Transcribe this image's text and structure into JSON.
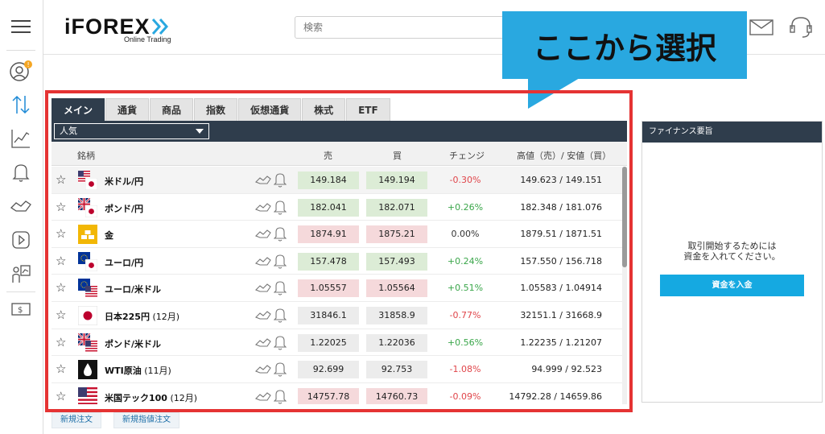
{
  "header": {
    "logo_main": "iFOREX",
    "logo_sub": "Online Trading",
    "search_placeholder": "検索"
  },
  "callout": {
    "text": "ここから選択",
    "color": "#29a8e0"
  },
  "tabs": [
    {
      "label": "メイン",
      "active": true
    },
    {
      "label": "通貨"
    },
    {
      "label": "商品"
    },
    {
      "label": "指数"
    },
    {
      "label": "仮想通貨"
    },
    {
      "label": "株式"
    },
    {
      "label": "ETF"
    }
  ],
  "filter": {
    "selected": "人気"
  },
  "table": {
    "headers": {
      "symbol": "銘柄",
      "sell": "売",
      "buy": "買",
      "change": "チェンジ",
      "highlow": "高値（売）/ 安値（買）"
    },
    "rows": [
      {
        "name": "米ドル/円",
        "sub": "",
        "flag": "us-jp",
        "sell": "149.184",
        "buy": "149.194",
        "trend": "up",
        "change": "-0.30%",
        "change_dir": "neg",
        "highlow": "149.623 / 149.151"
      },
      {
        "name": "ポンド/円",
        "sub": "",
        "flag": "uk-jp",
        "sell": "182.041",
        "buy": "182.071",
        "trend": "up",
        "change": "+0.26%",
        "change_dir": "pos",
        "highlow": "182.348 / 181.076"
      },
      {
        "name": "金",
        "sub": "",
        "flag": "gold",
        "sell": "1874.91",
        "buy": "1875.21",
        "trend": "down",
        "change": "0.00%",
        "change_dir": "zero",
        "highlow": "1879.51 / 1871.51"
      },
      {
        "name": "ユーロ/円",
        "sub": "",
        "flag": "eu-jp",
        "sell": "157.478",
        "buy": "157.493",
        "trend": "up",
        "change": "+0.24%",
        "change_dir": "pos",
        "highlow": "157.550 / 156.718"
      },
      {
        "name": "ユーロ/米ドル",
        "sub": "",
        "flag": "eu-us",
        "sell": "1.05557",
        "buy": "1.05564",
        "trend": "down",
        "change": "+0.51%",
        "change_dir": "pos",
        "highlow": "1.05583 / 1.04914"
      },
      {
        "name": "日本225円",
        "sub": " (12月)",
        "flag": "jp",
        "sell": "31846.1",
        "buy": "31858.9",
        "trend": "flat",
        "change": "-0.77%",
        "change_dir": "neg",
        "highlow": "32151.1 / 31668.9"
      },
      {
        "name": "ポンド/米ドル",
        "sub": "",
        "flag": "uk-us",
        "sell": "1.22025",
        "buy": "1.22036",
        "trend": "flat",
        "change": "+0.56%",
        "change_dir": "pos",
        "highlow": "1.22235 / 1.21207"
      },
      {
        "name": "WTI原油",
        "sub": " (11月)",
        "flag": "oil",
        "sell": "92.699",
        "buy": "92.753",
        "trend": "flat",
        "change": "-1.08%",
        "change_dir": "neg",
        "highlow": "94.999 / 92.523"
      },
      {
        "name": "米国テック100",
        "sub": " (12月)",
        "flag": "us",
        "sell": "14757.78",
        "buy": "14760.73",
        "trend": "down",
        "change": "-0.09%",
        "change_dir": "neg",
        "highlow": "14792.28 / 14659.86"
      }
    ]
  },
  "bottom_buttons": {
    "new_order": "新規注文",
    "new_limit_order": "新規指値注文"
  },
  "panel": {
    "title": "ファイナンス要旨",
    "message_line1": "取引開始するためには",
    "message_line2": "資金を入れてください。",
    "deposit_button": "資金を入金"
  }
}
